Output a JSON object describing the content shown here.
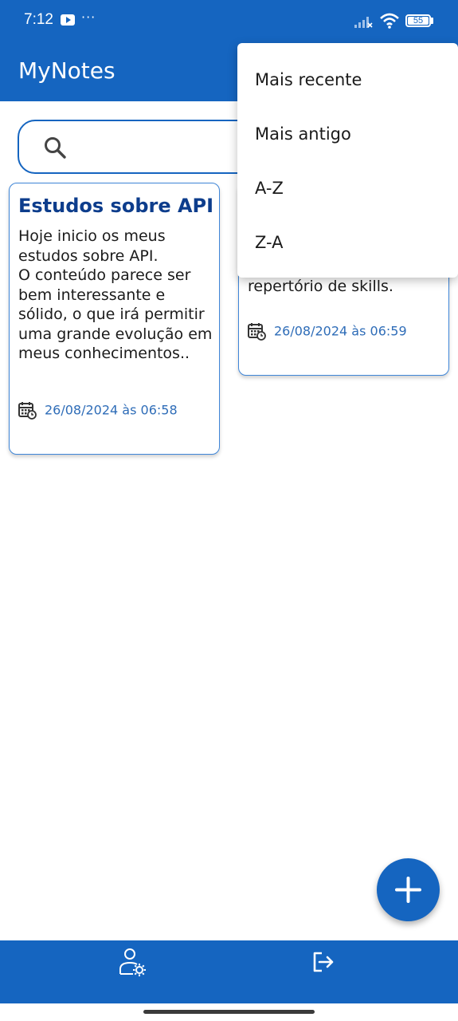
{
  "status_bar": {
    "time": "7:12",
    "battery": "55"
  },
  "app_bar": {
    "title": "MyNotes"
  },
  "search": {
    "placeholder": "",
    "value": ""
  },
  "notes": [
    {
      "title": "Estudos sobre API",
      "body": "Hoje inicio os meus estudos sobre API.\nO conteúdo parece ser bem interessante e sólido, o que irá permitir uma grande evolução em meus conhecimentos..",
      "date": "26/08/2024 às 06:58"
    },
    {
      "body_visible": "aumentando o\nrepertório de skills.",
      "date": "26/08/2024 às 06:59"
    }
  ],
  "sort_menu": {
    "items": [
      "Mais recente",
      "Mais antigo",
      "A-Z",
      "Z-A"
    ]
  },
  "colors": {
    "primary": "#1565c0",
    "title_text": "#0d3d8c",
    "date_text": "#2f6db8",
    "card_border": "#3f86d8"
  },
  "icons": {
    "search": "search-icon",
    "calendar": "calendar-clock-icon",
    "add": "plus-icon",
    "profile_settings": "user-settings-icon",
    "logout": "logout-icon"
  }
}
